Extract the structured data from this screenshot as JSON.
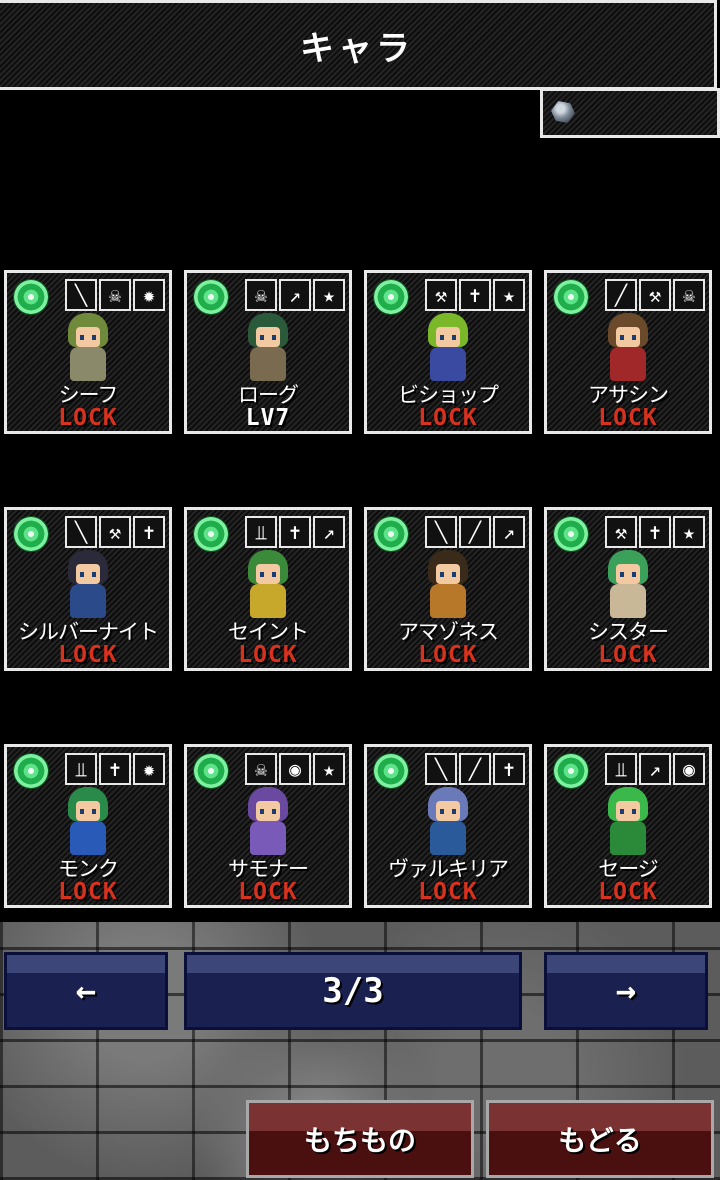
{
  "header": {
    "title": "キャラ"
  },
  "currency": {
    "icon": "gem-icon",
    "value": ""
  },
  "colors": {
    "lock": "#d8321e",
    "nav_button": "#1a2050",
    "menu_button": "#4a1010",
    "orb": "#1fae4b"
  },
  "characters": [
    {
      "name": "シーフ",
      "status": "LOCK",
      "skills": [
        "sword-icon",
        "skull-icon",
        "burst-icon"
      ],
      "hair": "#6f8a3a",
      "body": "#8a8a6a"
    },
    {
      "name": "ローグ",
      "status": "LV7",
      "skills": [
        "skull-icon",
        "bow-icon",
        "star-icon"
      ],
      "hair": "#2a5a3a",
      "body": "#7a6a50"
    },
    {
      "name": "ビショップ",
      "status": "LOCK",
      "skills": [
        "axe-icon",
        "cross-icon",
        "star-icon"
      ],
      "hair": "#7ab82a",
      "body": "#3a4aa0"
    },
    {
      "name": "アサシン",
      "status": "LOCK",
      "skills": [
        "spear-icon",
        "axe-icon",
        "skull-icon"
      ],
      "hair": "#6a4a2a",
      "body": "#a02828"
    },
    {
      "name": "シルバーナイト",
      "status": "LOCK",
      "skills": [
        "sword-icon",
        "axe-icon",
        "cross-icon"
      ],
      "hair": "#2a2a3a",
      "body": "#2a4a8a"
    },
    {
      "name": "セイント",
      "status": "LOCK",
      "skills": [
        "staff-icon",
        "cross-icon",
        "bow-icon"
      ],
      "hair": "#3a8a3a",
      "body": "#c8a82a"
    },
    {
      "name": "アマゾネス",
      "status": "LOCK",
      "skills": [
        "sword-icon",
        "spear-icon",
        "bow-icon"
      ],
      "hair": "#3a2a1a",
      "body": "#b8782a"
    },
    {
      "name": "シスター",
      "status": "LOCK",
      "skills": [
        "axe-icon",
        "cross-icon",
        "star-icon"
      ],
      "hair": "#3aa05a",
      "body": "#c8b898"
    },
    {
      "name": "モンク",
      "status": "LOCK",
      "skills": [
        "staff-icon",
        "cross-icon",
        "burst-icon"
      ],
      "hair": "#2a8a4a",
      "body": "#2a5ab8"
    },
    {
      "name": "サモナー",
      "status": "LOCK",
      "skills": [
        "skull-icon",
        "eye-icon",
        "star-icon"
      ],
      "hair": "#6a4aa0",
      "body": "#7a5ab8"
    },
    {
      "name": "ヴァルキリア",
      "status": "LOCK",
      "skills": [
        "sword-icon",
        "spear-icon",
        "cross-icon"
      ],
      "hair": "#6a7ab8",
      "body": "#2a5a9a"
    },
    {
      "name": "セージ",
      "status": "LOCK",
      "skills": [
        "staff-icon",
        "bow-icon",
        "eye-icon"
      ],
      "hair": "#3ab84a",
      "body": "#2a8a3a"
    }
  ],
  "pagination": {
    "prev": "←",
    "page": "3/3",
    "next": "→"
  },
  "menu": {
    "items_label": "もちもの",
    "back_label": "もどる"
  }
}
